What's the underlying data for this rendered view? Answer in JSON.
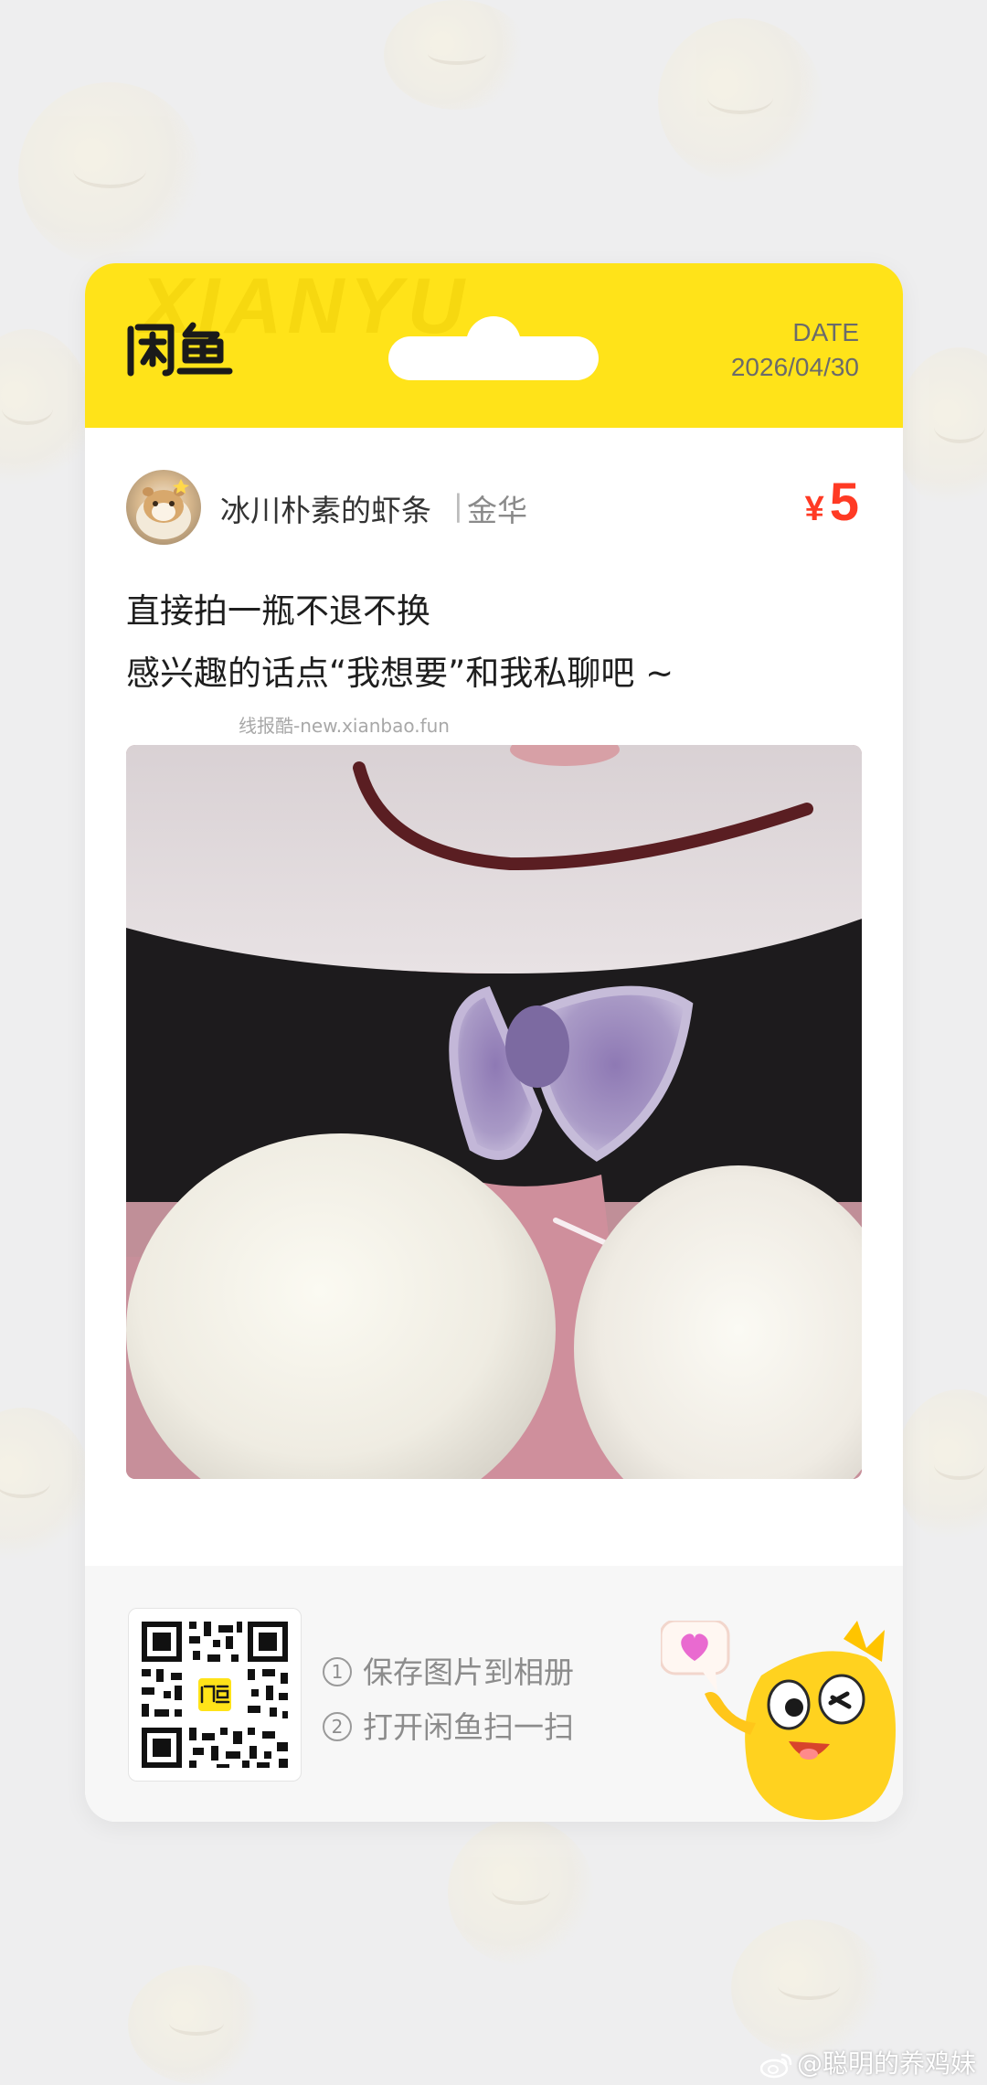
{
  "header": {
    "brand_watermark": "XIANYU",
    "logo_name": "闲鱼",
    "date_label": "DATE",
    "date_value": "2026/04/30"
  },
  "seller": {
    "name": "冰川朴素的虾条",
    "separator": "|",
    "location": "金华"
  },
  "price": {
    "currency": "¥",
    "value": "5"
  },
  "description": {
    "line1": "直接拍一瓶不退不换",
    "line2": "感兴趣的话点“我想要”和我私聊吧 ~"
  },
  "source_watermark": "线报酷-new.xianbao.fun",
  "footer": {
    "step1_num": "1",
    "step1": "保存图片到相册",
    "step2_num": "2",
    "step2": "打开闲鱼扫一扫"
  },
  "weibo_watermark": "@聪明的养鸡妹",
  "colors": {
    "header_yellow": "#ffe319",
    "price_red": "#ff3a24",
    "background": "#eeeeef"
  }
}
